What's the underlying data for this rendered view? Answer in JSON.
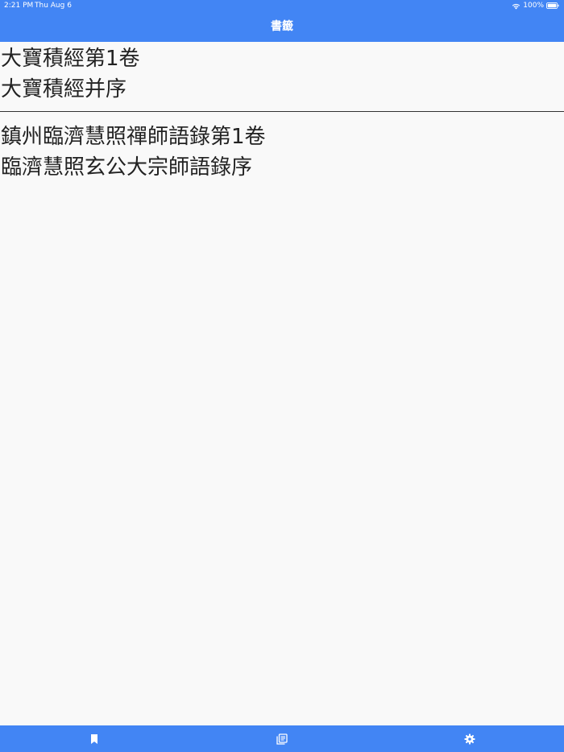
{
  "status_bar": {
    "time": "2:21 PM",
    "date": "Thu Aug 6",
    "battery": "100%",
    "icons": [
      "wifi-icon",
      "battery-icon"
    ]
  },
  "header": {
    "title": "書籤"
  },
  "bookmarks": [
    {
      "line1": "大寶積經第1卷",
      "line2": "大寶積經并序"
    },
    {
      "line1": "鎮州臨濟慧照禪師語錄第1卷",
      "line2": "臨濟慧照玄公大宗師語錄序"
    }
  ],
  "tab_bar": {
    "tabs": [
      {
        "icon": "bookmark-icon"
      },
      {
        "icon": "book-list-icon"
      },
      {
        "icon": "gear-icon"
      }
    ]
  },
  "colors": {
    "accent": "#4285f4",
    "background": "#f9f9f9",
    "text": "#222222"
  }
}
